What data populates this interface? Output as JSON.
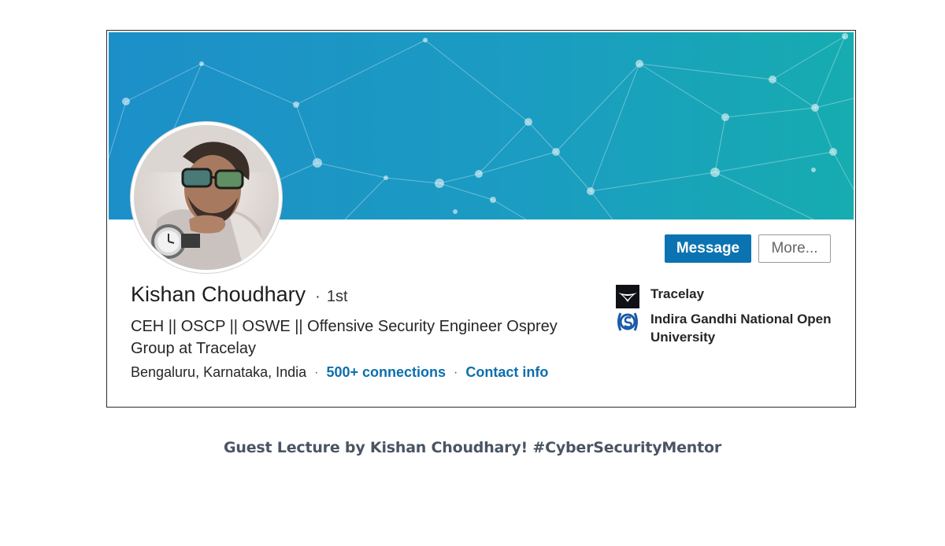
{
  "profile": {
    "name": "Kishan Choudhary",
    "degree_separator": "·",
    "degree": "1st",
    "headline": "CEH || OSCP || OSWE || Offensive Security Engineer Osprey Group at Tracelay",
    "location": "Bengaluru, Karnataka, India",
    "meta_separator": "·",
    "connections_label": "500+ connections",
    "contact_label": "Contact info"
  },
  "actions": {
    "message_label": "Message",
    "more_label": "More..."
  },
  "experience": [
    {
      "label": "Tracelay",
      "logo": "tracelay-logo"
    },
    {
      "label": "Indira Gandhi National Open University",
      "logo": "ignou-logo"
    }
  ],
  "caption": "Guest Lecture by Kishan Choudhary! #CyberSecurityMentor",
  "colors": {
    "banner_start": "#1c8fc8",
    "banner_end": "#16acb0",
    "link": "#0b6fae",
    "primary_button": "#0b73b1"
  }
}
